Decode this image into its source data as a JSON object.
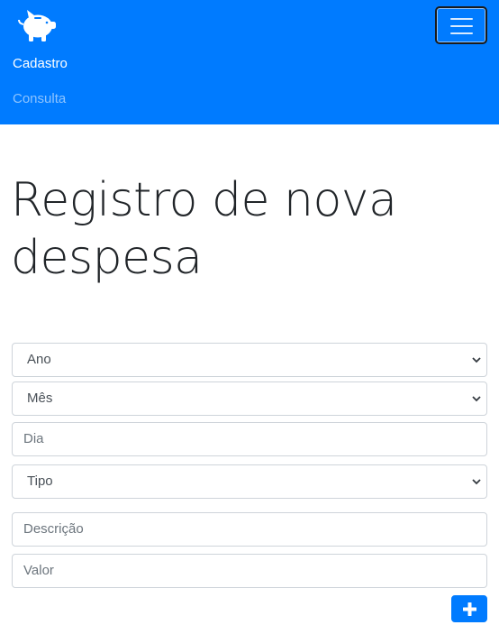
{
  "navbar": {
    "brand_icon": "piggy-bank-icon",
    "links": [
      {
        "label": "Cadastro",
        "active": true
      },
      {
        "label": "Consulta",
        "active": false
      }
    ],
    "toggler_icon": "hamburger-menu-icon"
  },
  "main": {
    "title": "Registro de nova despesa"
  },
  "form": {
    "ano_label": "Ano",
    "mes_label": "Mês",
    "dia_placeholder": "Dia",
    "tipo_label": "Tipo",
    "descricao_placeholder": "Descrição",
    "valor_placeholder": "Valor",
    "add_button_icon": "plus-icon"
  },
  "colors": {
    "primary": "#007bff",
    "nav_active": "#ffffff",
    "nav_inactive": "rgba(255,255,255,0.55)",
    "input_border": "#ced4da"
  }
}
